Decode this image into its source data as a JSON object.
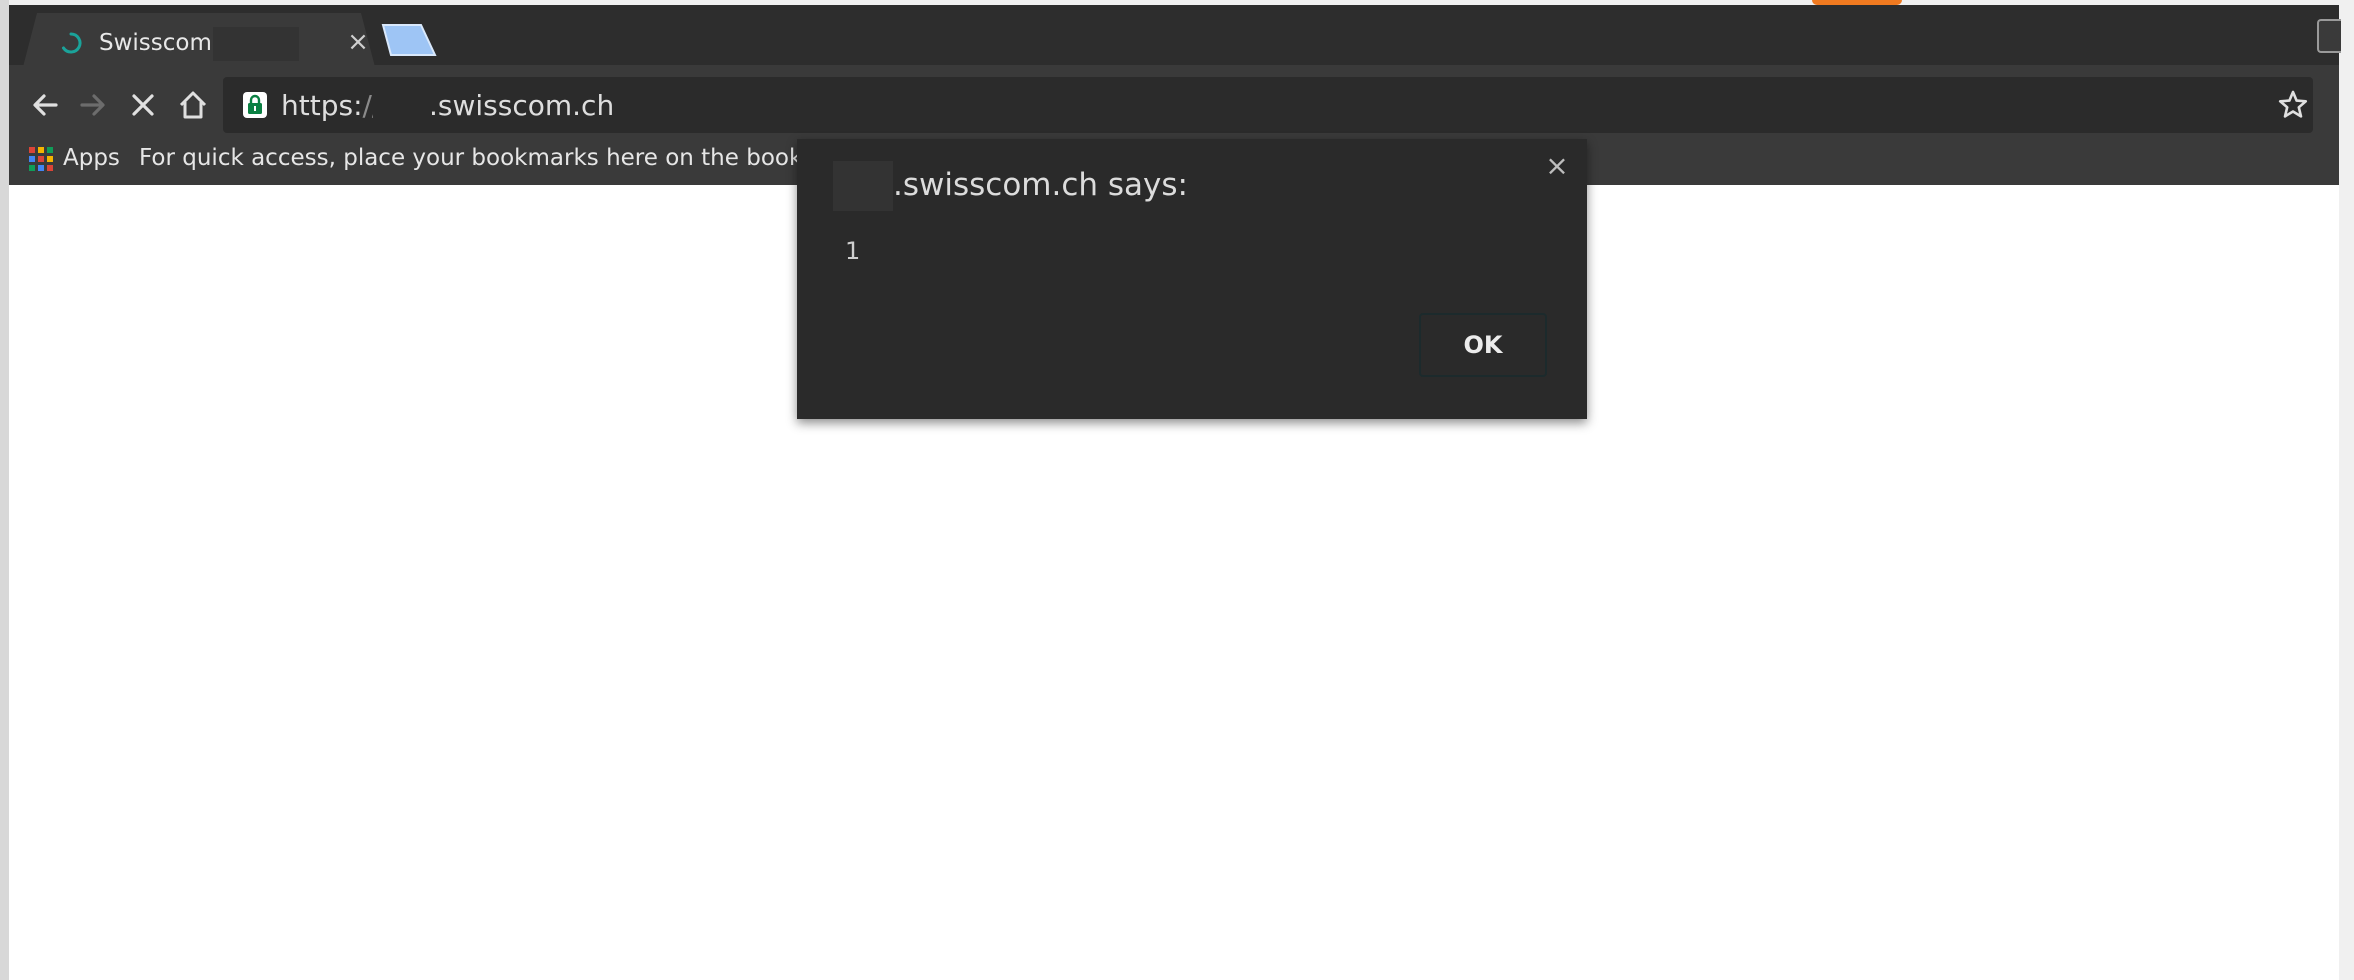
{
  "browser": {
    "tab": {
      "title": "Swisscom",
      "close_label": "×"
    },
    "omnibox": {
      "scheme": "https:",
      "separator": "//",
      "host": ".swisscom.ch"
    },
    "bookmarks": {
      "apps_label": "Apps",
      "hint": "For quick access, place your bookmarks here on the bookmarks bar."
    }
  },
  "dialog": {
    "title": ".swisscom.ch says:",
    "close_label": "×",
    "message": "1",
    "ok_label": "OK"
  },
  "colors": {
    "chrome_dark": "#2d2d2d",
    "toolbar": "#3a3a3a",
    "dialog_bg": "#2a2a2a",
    "spinner": "#1aa39a",
    "lock_green": "#0b8043",
    "newtab_blue": "#9ec5f5"
  }
}
